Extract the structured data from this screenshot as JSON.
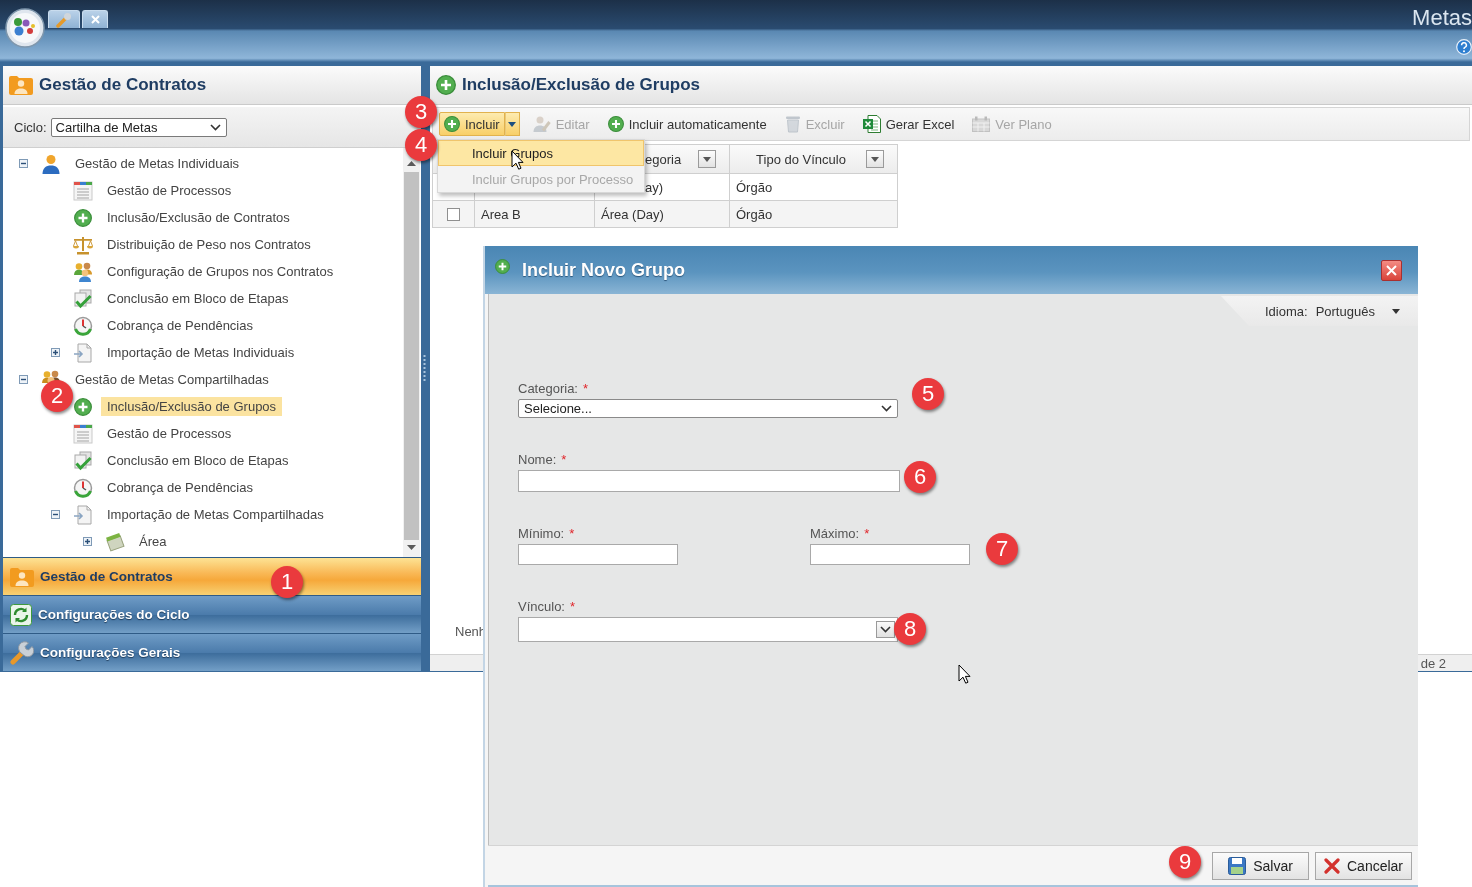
{
  "app_bar": {
    "title": "Metas"
  },
  "left_panel": {
    "title": "Gestão de Contratos",
    "cycle": {
      "label": "Ciclo:",
      "value": "Cartilha de Metas"
    },
    "tree": [
      {
        "label": "Gestão de Metas Individuais",
        "kind": "user",
        "expanded": true,
        "selected": false,
        "children": [
          {
            "label": "Gestão de Processos",
            "kind": "processes",
            "selected": false
          },
          {
            "label": "Inclusão/Exclusão de Contratos",
            "kind": "add",
            "selected": false
          },
          {
            "label": "Distribuição de Peso nos Contratos",
            "kind": "weights",
            "selected": false
          },
          {
            "label": "Configuração de Grupos nos Contratos",
            "kind": "groups",
            "selected": false
          },
          {
            "label": "Conclusão em Bloco de Etapas",
            "kind": "bulk",
            "selected": false
          },
          {
            "label": "Cobrança de Pendências",
            "kind": "pending",
            "selected": false
          },
          {
            "label": "Importação de Metas Individuais",
            "kind": "import",
            "expanded": false,
            "selected": false
          }
        ]
      },
      {
        "label": "Gestão de Metas Compartilhadas",
        "kind": "users",
        "expanded": true,
        "selected": false,
        "children": [
          {
            "label": "Inclusão/Exclusão de Grupos",
            "kind": "add",
            "selected": true
          },
          {
            "label": "Gestão de Processos",
            "kind": "processes",
            "selected": false
          },
          {
            "label": "Conclusão em Bloco de Etapas",
            "kind": "bulk",
            "selected": false
          },
          {
            "label": "Cobrança de Pendências",
            "kind": "pending",
            "selected": false
          },
          {
            "label": "Importação de Metas Compartilhadas",
            "kind": "import",
            "expanded": true,
            "selected": false,
            "children": [
              {
                "label": "Área",
                "kind": "area",
                "expanded": false,
                "selected": false
              }
            ]
          }
        ]
      }
    ],
    "sections": [
      {
        "label": "Gestão de Contratos",
        "kind": "contracts",
        "selected": true
      },
      {
        "label": "Configurações do Ciclo",
        "kind": "cycle",
        "selected": false
      },
      {
        "label": "Configurações Gerais",
        "kind": "settings",
        "selected": false
      }
    ]
  },
  "main_panel": {
    "title": "Inclusão/Exclusão de Grupos",
    "toolbar": [
      {
        "label": "Incluir",
        "kind": "add",
        "disabled": false,
        "expanded": true,
        "menu": [
          {
            "label": "Incluir Grupos",
            "selected": true,
            "disabled": false
          },
          {
            "label": "Incluir Grupos por Processo",
            "selected": false,
            "disabled": true
          }
        ]
      },
      {
        "label": "Editar",
        "kind": "edit",
        "disabled": true
      },
      {
        "label": "Incluir automaticamente",
        "kind": "add",
        "disabled": false
      },
      {
        "label": "Excluir",
        "kind": "delete",
        "disabled": true
      },
      {
        "label": "Gerar Excel",
        "kind": "export",
        "disabled": false
      },
      {
        "label": "Ver Plano",
        "kind": "plan",
        "disabled": true
      }
    ],
    "grid": {
      "columns": [
        {
          "label": "egoria"
        },
        {
          "label": "Tipo do Vínculo"
        }
      ],
      "rows": [
        {
          "cells": [
            "ay)",
            "Órgão"
          ]
        },
        {
          "checked": false,
          "cells": [
            "Area B",
            "Área (Day)",
            "Órgão"
          ]
        }
      ]
    },
    "message": "Nenh",
    "pager": {
      "text": "de 2"
    }
  },
  "dialog": {
    "title": "Incluir Novo Grupo",
    "language": {
      "label": "Idioma:",
      "value": "Português"
    },
    "form_rows": [
      {
        "fields": [
          {
            "kind": "select",
            "label": "Categoria:",
            "required_mark": "*",
            "value": "Selecione..."
          }
        ]
      },
      {
        "fields": [
          {
            "kind": "text",
            "label": "Nome:",
            "required_mark": "*"
          }
        ]
      },
      {
        "fields": [
          {
            "kind": "text",
            "label": "Mínimo:",
            "required_mark": "*"
          },
          {
            "kind": "text",
            "label": "Máximo:",
            "required_mark": "*"
          }
        ]
      },
      {
        "fields": [
          {
            "kind": "combo",
            "label": "Vínculo:",
            "required_mark": "*"
          }
        ]
      }
    ],
    "buttons": [
      {
        "label": "Salvar",
        "kind": "save"
      },
      {
        "label": "Cancelar",
        "kind": "cancel"
      }
    ]
  },
  "callouts": [
    "1",
    "2",
    "3",
    "4",
    "5",
    "6",
    "7",
    "8",
    "9"
  ]
}
